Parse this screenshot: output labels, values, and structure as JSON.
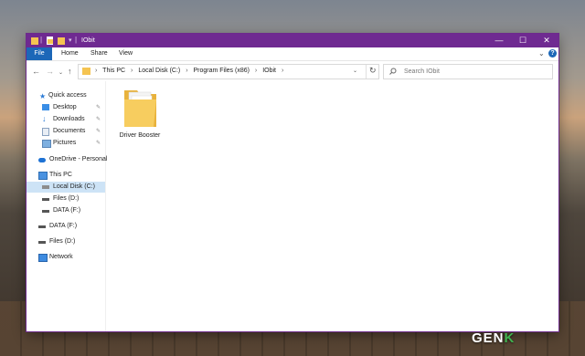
{
  "window": {
    "title": "IObit",
    "ribbon_tabs": [
      "File",
      "Home",
      "Share",
      "View"
    ],
    "controls": {
      "minimize": "—",
      "maximize": "☐",
      "close": "✕"
    }
  },
  "address": {
    "crumbs": [
      "This PC",
      "Local Disk (C:)",
      "Program Files (x86)",
      "IObit"
    ],
    "search_placeholder": "Search IObit"
  },
  "nav_pane": {
    "quick_access": "Quick access",
    "pinned": [
      "Desktop",
      "Downloads",
      "Documents",
      "Pictures"
    ],
    "onedrive": "OneDrive - Personal",
    "this_pc": "This PC",
    "this_pc_items": [
      "Local Disk (C:)",
      "Files (D:)",
      "DATA (F:)"
    ],
    "drives": [
      "DATA (F:)",
      "Files (D:)"
    ],
    "network": "Network"
  },
  "content": {
    "items": [
      {
        "name": "Driver Booster",
        "type": "folder"
      }
    ]
  },
  "watermark": {
    "text": "GEN",
    "accent": "K"
  },
  "colors": {
    "titlebar": "#6f2a91",
    "file_tab": "#1c67b8",
    "selected": "#cde3f6"
  }
}
